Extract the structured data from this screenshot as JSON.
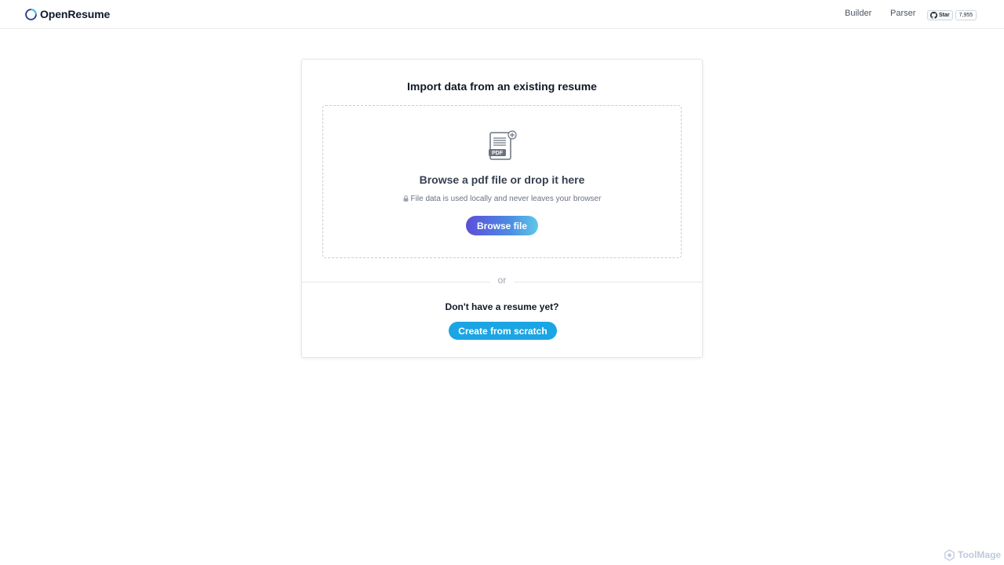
{
  "header": {
    "logo_text": "OpenResume",
    "nav": {
      "builder": "Builder",
      "parser": "Parser"
    },
    "github": {
      "star_label": "Star",
      "star_count": "7,955"
    }
  },
  "card": {
    "title": "Import data from an existing resume",
    "dropzone": {
      "icon": "pdf-file-add-icon",
      "title": "Browse a pdf file or drop it here",
      "note": "File data is used locally and never leaves your browser",
      "browse_label": "Browse file"
    },
    "or_label": "or",
    "no_resume_text": "Don't have a resume yet?",
    "create_label": "Create from scratch"
  },
  "watermark": "ToolMage",
  "colors": {
    "accent_gradient": [
      "#5b4fd8",
      "#5fc7e8"
    ],
    "create_button": "#1ba5e3",
    "logo_ring": "#3b82f6"
  }
}
